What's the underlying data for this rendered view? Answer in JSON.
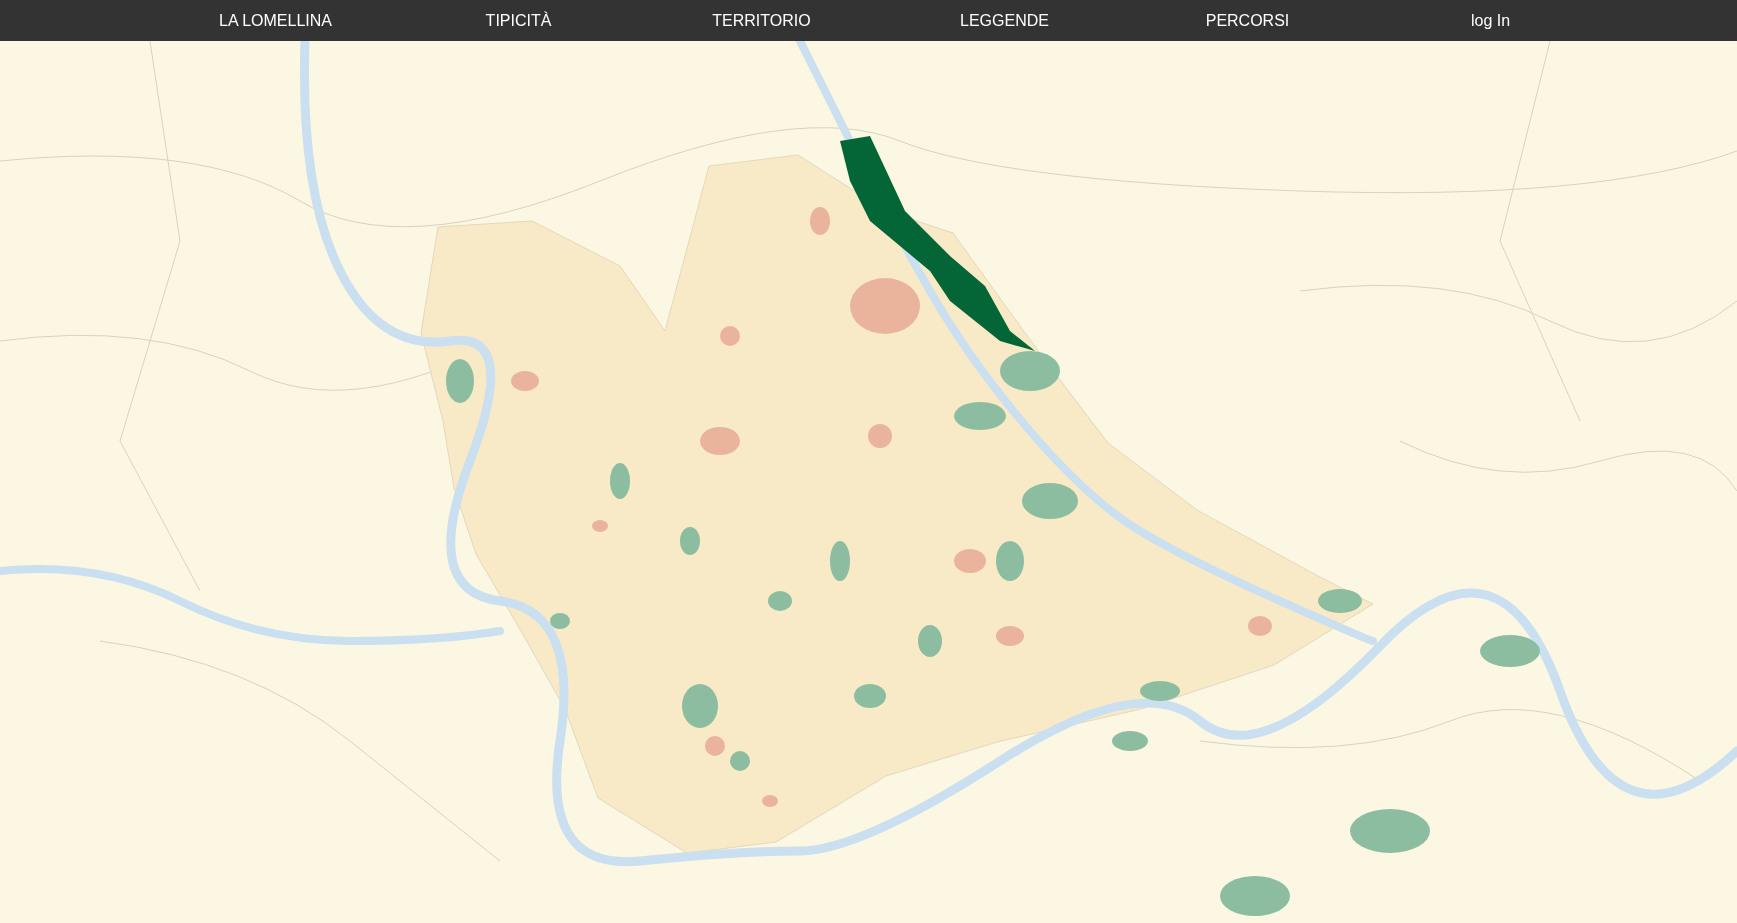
{
  "nav": {
    "items": [
      {
        "label": "LA LOMELLINA"
      },
      {
        "label": "TIPICITÀ"
      },
      {
        "label": "TERRITORIO"
      },
      {
        "label": "LEGGENDE"
      },
      {
        "label": "PERCORSI"
      },
      {
        "label": "log In"
      }
    ]
  }
}
